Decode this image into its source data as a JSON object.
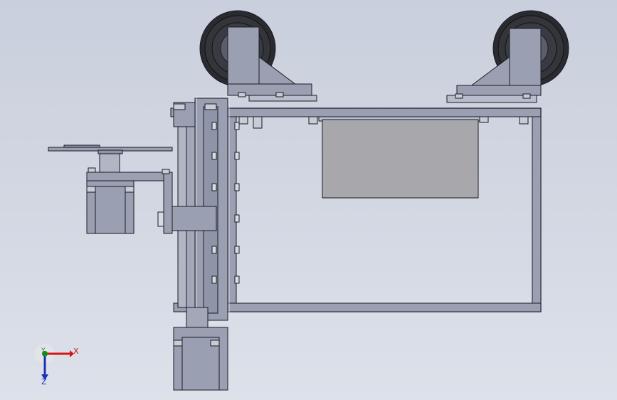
{
  "viewport": {
    "background_top": "#c9cfdc",
    "background_bottom": "#dde1ea",
    "part_fill": "#9aa0b2",
    "part_dark": "#6e7388",
    "edge_color": "#1a1c24",
    "plate_fill": "#a8a8ac"
  },
  "triad": {
    "x_label": "X",
    "y_label": "Y",
    "z_label": "Z",
    "x_color": "#d01818",
    "y_color": "#1a8a1a",
    "z_color": "#1b2fb8"
  }
}
